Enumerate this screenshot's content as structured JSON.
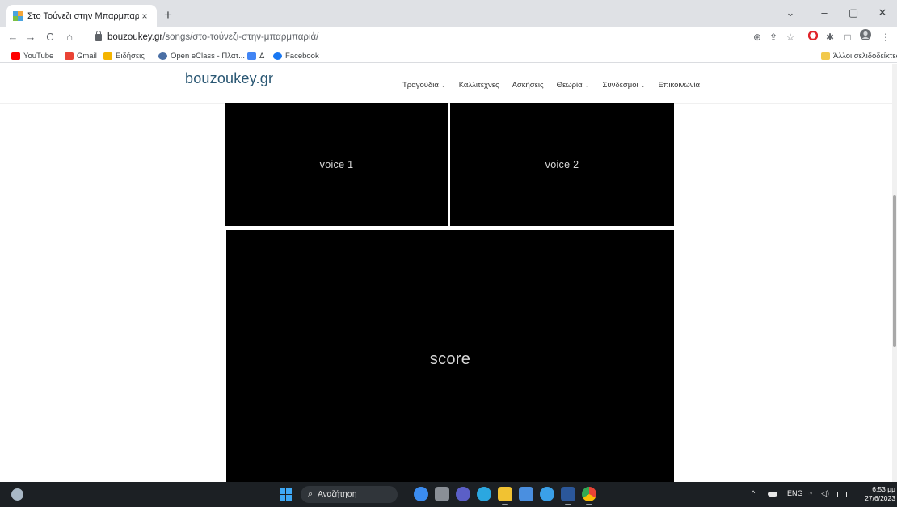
{
  "browser": {
    "tab_title": "Στο Τούνεζι στην Μπαρμπαριά",
    "tab_close": "×",
    "new_tab": "+",
    "url_host": "bouzoukey.gr",
    "url_path": "/songs/στο-τούνεζι-στην-μπαρμπαριά/",
    "icons": {
      "back": "←",
      "forward": "→",
      "reload": "C",
      "home": "⌂",
      "zoom": "⊕",
      "share": "⇪",
      "star": "☆",
      "extensions": "✱",
      "sidebar": "□",
      "menu": "⋮",
      "minimize": "–",
      "maximize": "▢",
      "close": "✕",
      "tab_search": "⌄"
    }
  },
  "bookmarks": {
    "items": [
      {
        "label": "YouTube",
        "color": "#ff0000"
      },
      {
        "label": "Gmail",
        "color": "#ea4335"
      },
      {
        "label": "Ειδήσεις",
        "color": "#f4b400"
      },
      {
        "label": "Open eClass - Πλατ...",
        "color": "#4a6fa5"
      },
      {
        "label": "Δ",
        "color": "#4285f4"
      },
      {
        "label": "Facebook",
        "color": "#1877f2"
      }
    ],
    "other_bookmarks": "Άλλοι σελιδοδείκτες"
  },
  "site": {
    "logo": "bouzoukey.gr",
    "nav": [
      {
        "label": "Τραγούδια",
        "has_dropdown": true
      },
      {
        "label": "Καλλιτέχνες",
        "has_dropdown": false
      },
      {
        "label": "Ασκήσεις",
        "has_dropdown": false
      },
      {
        "label": "Θεωρία",
        "has_dropdown": true
      },
      {
        "label": "Σύνδεσμοι",
        "has_dropdown": true
      },
      {
        "label": "Επικοινωνία",
        "has_dropdown": false
      }
    ],
    "chevron": "⌄",
    "voice1": "voice 1",
    "voice2": "voice 2",
    "score": "score"
  },
  "taskbar": {
    "search_placeholder": "Αναζήτηση",
    "search_icon": "⌕",
    "language": "ENG",
    "tray_chevron": "^",
    "time": "6:53 μμ",
    "date": "27/6/2023"
  }
}
